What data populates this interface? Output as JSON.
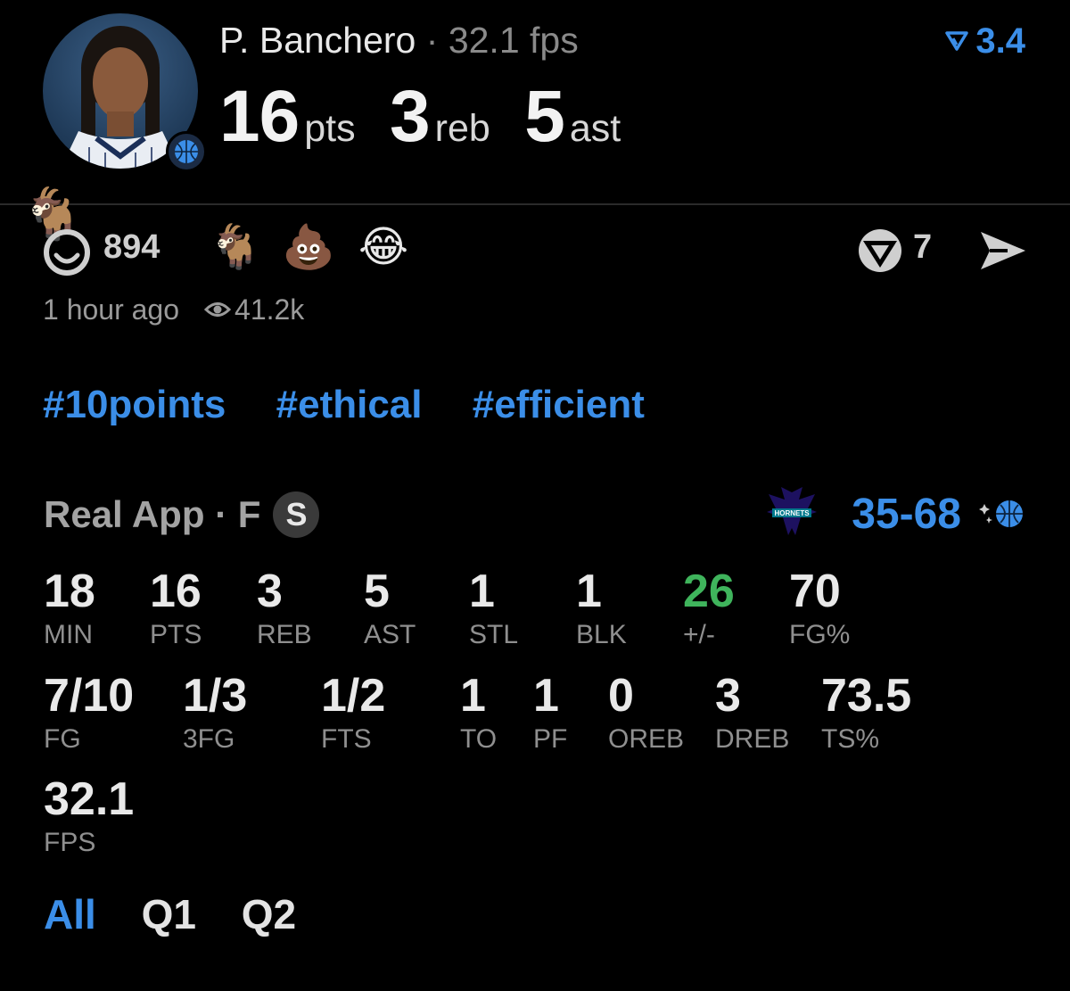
{
  "player": {
    "name": "P. Banchero",
    "separator": "·",
    "fps": "32.1 fps",
    "pts": "16",
    "pts_unit": "pts",
    "reb": "3",
    "reb_unit": "reb",
    "ast": "5",
    "ast_unit": "ast"
  },
  "rating": {
    "icon": "vote-arrow-icon",
    "value": "3.4"
  },
  "reactions": {
    "count": "894",
    "emoji_goat": "🐐",
    "emoji_poop": "💩",
    "emoji_laugh": "😂",
    "vote_count": "7"
  },
  "meta": {
    "time": "1 hour ago",
    "views": "41.2k"
  },
  "hashtags": [
    "#10points",
    "#ethical",
    "#efficient"
  ],
  "game": {
    "title": "Real App · F",
    "badge": "S",
    "score": "35-68",
    "score_color": "#3b8ee8"
  },
  "stats_row1": [
    {
      "value": "18",
      "label": "MIN"
    },
    {
      "value": "16",
      "label": "PTS"
    },
    {
      "value": "3",
      "label": "REB"
    },
    {
      "value": "5",
      "label": "AST"
    },
    {
      "value": "1",
      "label": "STL"
    },
    {
      "value": "1",
      "label": "BLK"
    },
    {
      "value": "26",
      "label": "+/-"
    },
    {
      "value": "70",
      "label": "FG%"
    }
  ],
  "stats_row2": [
    {
      "value": "7/10",
      "label": "FG"
    },
    {
      "value": "1/3",
      "label": "3FG"
    },
    {
      "value": "1/2",
      "label": "FTS"
    },
    {
      "value": "1",
      "label": "TO"
    },
    {
      "value": "1",
      "label": "PF"
    },
    {
      "value": "0",
      "label": "OREB"
    },
    {
      "value": "3",
      "label": "DREB"
    },
    {
      "value": "73.5",
      "label": "TS%"
    }
  ],
  "stats_row3": [
    {
      "value": "32.1",
      "label": "FPS"
    }
  ],
  "periods": [
    "All",
    "Q1",
    "Q2"
  ],
  "colors": {
    "accent": "#3b8ee8",
    "positive": "#3fb45c",
    "background": "#000000"
  }
}
